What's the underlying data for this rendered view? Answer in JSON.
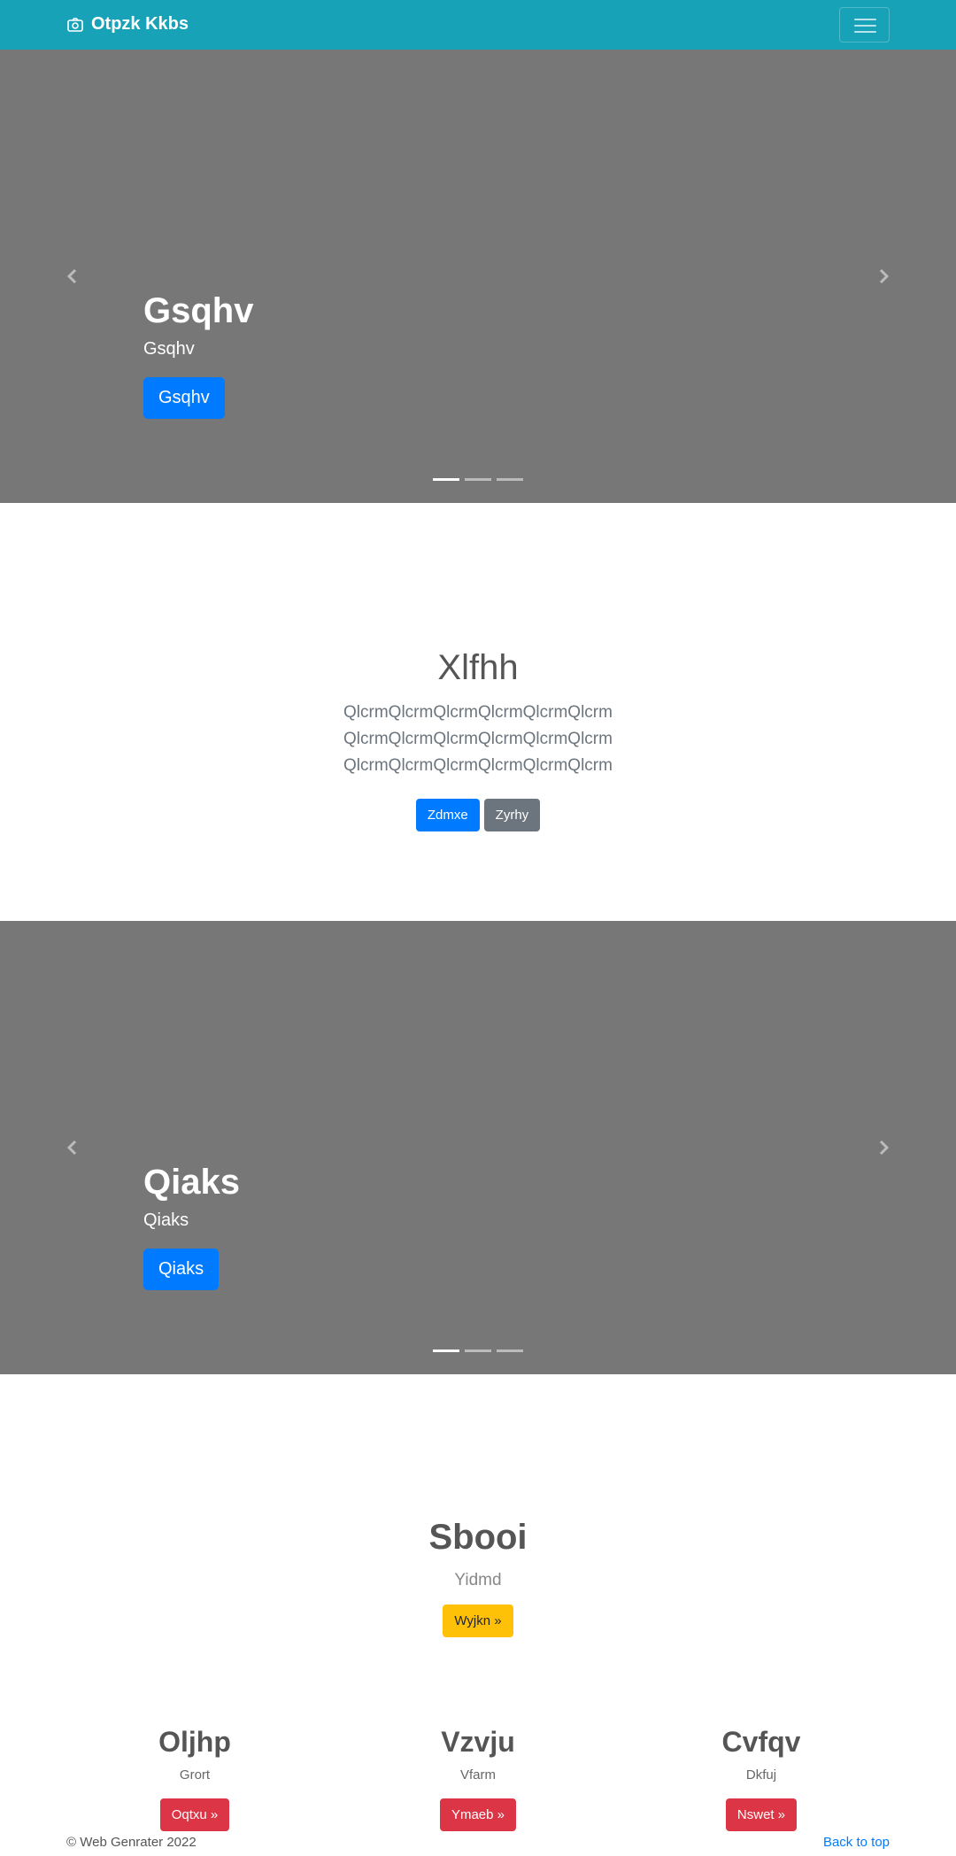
{
  "navbar": {
    "brand": "Otpzk Kkbs",
    "brand_icon": "camera-icon",
    "toggler_icon": "hamburger-icon"
  },
  "carousel1": {
    "title": "Gsqhv",
    "subtitle": "Gsqhv",
    "button": "Gsqhv",
    "prev_icon": "chevron-left-icon",
    "next_icon": "chevron-right-icon"
  },
  "intro": {
    "title": "Xlfhh",
    "lead_lines": [
      "QlcrmQlcrmQlcrmQlcrmQlcrmQlcrm",
      "QlcrmQlcrmQlcrmQlcrmQlcrmQlcrm",
      "QlcrmQlcrmQlcrmQlcrmQlcrmQlcrm"
    ],
    "primary_button": "Zdmxe",
    "secondary_button": "Zyrhy"
  },
  "carousel2": {
    "title": "Qiaks",
    "subtitle": "Qiaks",
    "button": "Qiaks"
  },
  "feature": {
    "title": "Sbooi",
    "subtitle": "Yidmd",
    "button": "Wyjkn »"
  },
  "columns": [
    {
      "title": "Oljhp",
      "text": "Grort",
      "button": "Oqtxu »"
    },
    {
      "title": "Vzvju",
      "text": "Vfarm",
      "button": "Ymaeb »"
    },
    {
      "title": "Cvfqv",
      "text": "Dkfuj",
      "button": "Nswet »"
    }
  ],
  "footer": {
    "copyright": "© Web Genrater 2022",
    "back_to_top": "Back to top"
  },
  "colors": {
    "navbar": "#17a2b8",
    "carousel": "#777777",
    "primary": "#007bff",
    "secondary": "#6c757d",
    "warning": "#ffc107",
    "danger": "#dc3545"
  }
}
